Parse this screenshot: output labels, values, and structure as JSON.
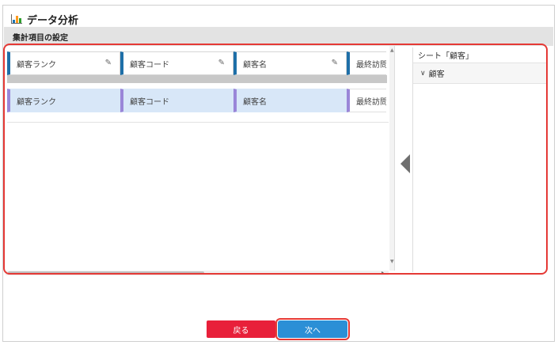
{
  "window": {
    "title": "データ分析",
    "app_icon": "bar-chart-icon"
  },
  "section": {
    "title": "集計項目の設定"
  },
  "fields_top": [
    {
      "label": "顧客ランク",
      "icon": "pencil-icon"
    },
    {
      "label": "顧客コード",
      "icon": "pencil-icon"
    },
    {
      "label": "顧客名",
      "icon": "pencil-icon"
    },
    {
      "label": "最終訪問日"
    }
  ],
  "fields_bottom": [
    {
      "label": "顧客ランク"
    },
    {
      "label": "顧客コード"
    },
    {
      "label": "顧客名"
    },
    {
      "label": "最終訪問日"
    }
  ],
  "sheet_panel": {
    "title": "シート「顧客」",
    "tree_root": "顧客",
    "expand_icon": "chevron-down-icon",
    "collapse_icon": "triangle-left-icon"
  },
  "buttons": {
    "back": "戻る",
    "next": "次へ"
  },
  "colors": {
    "back_button": "#e8203a",
    "next_button": "#2b8fd6",
    "highlight_frame": "#e53935",
    "field_accent_top": "#1e6fa8",
    "field_accent_bottom": "#9a86d8",
    "selected_row_bg": "#d8e7f8"
  }
}
